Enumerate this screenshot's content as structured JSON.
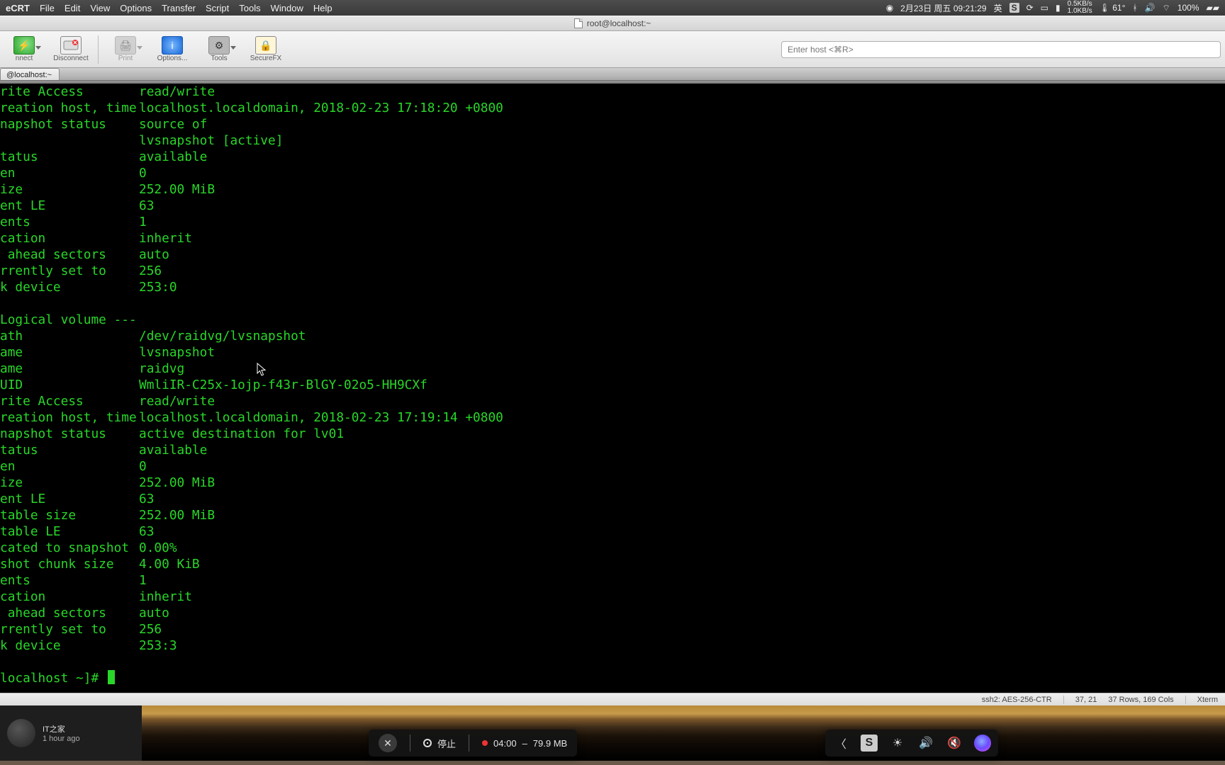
{
  "menubar": {
    "app_name": "eCRT",
    "items": [
      "File",
      "Edit",
      "View",
      "Options",
      "Transfer",
      "Script",
      "Tools",
      "Window",
      "Help"
    ],
    "status": {
      "date": "2月23日 周五 09:21:29",
      "ime": "英",
      "net_up": "0.5KB/s",
      "net_down": "1.0KB/s",
      "temp": "61°",
      "battery": "100%"
    }
  },
  "window": {
    "title": "root@localhost:~"
  },
  "toolbar": {
    "connect": "nnect",
    "disconnect": "Disconnect",
    "print": "Print",
    "options": "Options...",
    "tools": "Tools",
    "securefx": "SecureFX",
    "search_placeholder": "Enter host <⌘R>"
  },
  "tab": {
    "label": "@localhost:~"
  },
  "terminal": {
    "lines": [
      {
        "k": "rite Access",
        "v": "read/write"
      },
      {
        "k": "reation host, time",
        "v": "localhost.localdomain, 2018-02-23 17:18:20 +0800"
      },
      {
        "k": "napshot status",
        "v": "source of"
      },
      {
        "k": "",
        "v": "lvsnapshot [active]"
      },
      {
        "k": "tatus",
        "v": "available"
      },
      {
        "k": "en",
        "v": "0"
      },
      {
        "k": "ize",
        "v": "252.00 MiB"
      },
      {
        "k": "ent LE",
        "v": "63"
      },
      {
        "k": "ents",
        "v": "1"
      },
      {
        "k": "cation",
        "v": "inherit"
      },
      {
        "k": " ahead sectors",
        "v": "auto"
      },
      {
        "k": "rrently set to",
        "v": "256"
      },
      {
        "k": "k device",
        "v": "253:0"
      },
      {
        "k": "",
        "v": ""
      },
      {
        "k": "Logical volume ---",
        "v": ""
      },
      {
        "k": "ath",
        "v": "/dev/raidvg/lvsnapshot"
      },
      {
        "k": "ame",
        "v": "lvsnapshot"
      },
      {
        "k": "ame",
        "v": "raidvg"
      },
      {
        "k": "UID",
        "v": "WmliIR-C25x-1ojp-f43r-BlGY-02o5-HH9CXf"
      },
      {
        "k": "rite Access",
        "v": "read/write"
      },
      {
        "k": "reation host, time",
        "v": "localhost.localdomain, 2018-02-23 17:19:14 +0800"
      },
      {
        "k": "napshot status",
        "v": "active destination for lv01"
      },
      {
        "k": "tatus",
        "v": "available"
      },
      {
        "k": "en",
        "v": "0"
      },
      {
        "k": "ize",
        "v": "252.00 MiB"
      },
      {
        "k": "ent LE",
        "v": "63"
      },
      {
        "k": "table size",
        "v": "252.00 MiB"
      },
      {
        "k": "table LE",
        "v": "63"
      },
      {
        "k": "cated to snapshot",
        "v": "0.00%"
      },
      {
        "k": "shot chunk size",
        "v": "4.00 KiB"
      },
      {
        "k": "ents",
        "v": "1"
      },
      {
        "k": "cation",
        "v": "inherit"
      },
      {
        "k": " ahead sectors",
        "v": "auto"
      },
      {
        "k": "rrently set to",
        "v": "256"
      },
      {
        "k": "k device",
        "v": "253:3"
      }
    ],
    "prompt": "localhost ~]# "
  },
  "statusbar": {
    "conn": "ssh2: AES-256-CTR",
    "pos": "37, 21",
    "size": "37 Rows, 169 Cols",
    "term": "Xterm"
  },
  "yt": {
    "channel": "IT之家",
    "time": "1 hour ago"
  },
  "recorder": {
    "stop": "停止",
    "elapsed": "04:00",
    "size": "79.9 MB"
  }
}
